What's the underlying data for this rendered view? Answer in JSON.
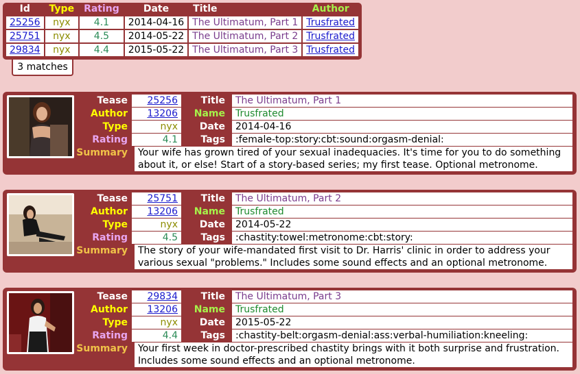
{
  "summary_table": {
    "headers": {
      "id": "Id",
      "type": "Type",
      "rating": "Rating",
      "date": "Date",
      "title": "Title",
      "author": "Author"
    },
    "rows": [
      {
        "id": "25256",
        "type": "nyx",
        "rating": "4.1",
        "date": "2014-04-16",
        "title": "The Ultimatum, Part 1",
        "author": "Trusfrated"
      },
      {
        "id": "25751",
        "type": "nyx",
        "rating": "4.5",
        "date": "2014-05-22",
        "title": "The Ultimatum, Part 2",
        "author": "Trusfrated"
      },
      {
        "id": "29834",
        "type": "nyx",
        "rating": "4.4",
        "date": "2015-05-22",
        "title": "The Ultimatum, Part 3",
        "author": "Trusfrated"
      }
    ],
    "matches": "3 matches"
  },
  "labels": {
    "tease": "Tease",
    "author": "Author",
    "type": "Type",
    "rating": "Rating",
    "summary": "Summary",
    "title": "Title",
    "name": "Name",
    "date": "Date",
    "tags": "Tags"
  },
  "cards": [
    {
      "tease": "25256",
      "author": "13206",
      "type": "nyx",
      "rating": "4.1",
      "title": "The Ultimatum, Part 1",
      "name": "Trusfrated",
      "date": "2014-04-16",
      "tags": ":female-top:story:cbt:sound:orgasm-denial:",
      "summary": "Your wife has grown tired of your sexual inadequacies. It's time for you to do something about it, or else! Start of a story-based series; my first tease. Optional metronome."
    },
    {
      "tease": "25751",
      "author": "13206",
      "type": "nyx",
      "rating": "4.5",
      "title": "The Ultimatum, Part 2",
      "name": "Trusfrated",
      "date": "2014-05-22",
      "tags": ":chastity:towel:metronome:cbt:story:",
      "summary": "The story of your wife-mandated first visit to Dr. Harris' clinic in order to address your various sexual \"problems.\" Includes some sound effects and an optional metronome."
    },
    {
      "tease": "29834",
      "author": "13206",
      "type": "nyx",
      "rating": "4.4",
      "title": "The Ultimatum, Part 3",
      "name": "Trusfrated",
      "date": "2015-05-22",
      "tags": ":chastity-belt:orgasm-denial:ass:verbal-humiliation:kneeling:",
      "summary": "Your first week in doctor-prescribed chastity brings with it both surprise and frustration. Includes some sound effects and an optional metronome."
    }
  ],
  "colors": {
    "panel": "#953436",
    "background": "#f2cccc",
    "link": "#1a1acc",
    "title_text": "#7a3c8c",
    "rating_text": "#2a8a56",
    "type_text": "#8c8c00",
    "name_text": "#1e8a2e"
  }
}
